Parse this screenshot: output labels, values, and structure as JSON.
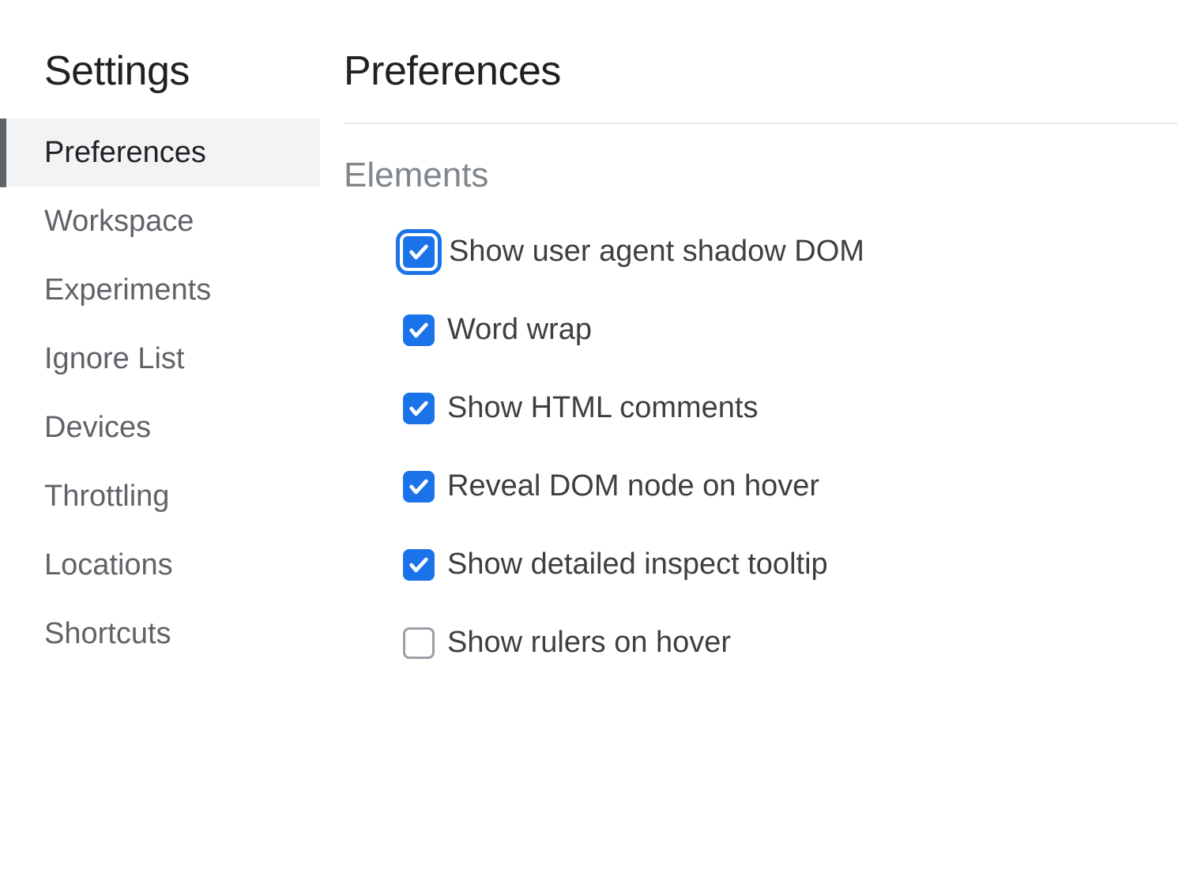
{
  "sidebar": {
    "title": "Settings",
    "items": [
      {
        "label": "Preferences",
        "active": true
      },
      {
        "label": "Workspace",
        "active": false
      },
      {
        "label": "Experiments",
        "active": false
      },
      {
        "label": "Ignore List",
        "active": false
      },
      {
        "label": "Devices",
        "active": false
      },
      {
        "label": "Throttling",
        "active": false
      },
      {
        "label": "Locations",
        "active": false
      },
      {
        "label": "Shortcuts",
        "active": false
      }
    ]
  },
  "main": {
    "title": "Preferences",
    "section_title": "Elements",
    "options": [
      {
        "label": "Show user agent shadow DOM",
        "checked": true,
        "focused": true
      },
      {
        "label": "Word wrap",
        "checked": true,
        "focused": false
      },
      {
        "label": "Show HTML comments",
        "checked": true,
        "focused": false
      },
      {
        "label": "Reveal DOM node on hover",
        "checked": true,
        "focused": false
      },
      {
        "label": "Show detailed inspect tooltip",
        "checked": true,
        "focused": false
      },
      {
        "label": "Show rulers on hover",
        "checked": false,
        "focused": false
      }
    ]
  }
}
